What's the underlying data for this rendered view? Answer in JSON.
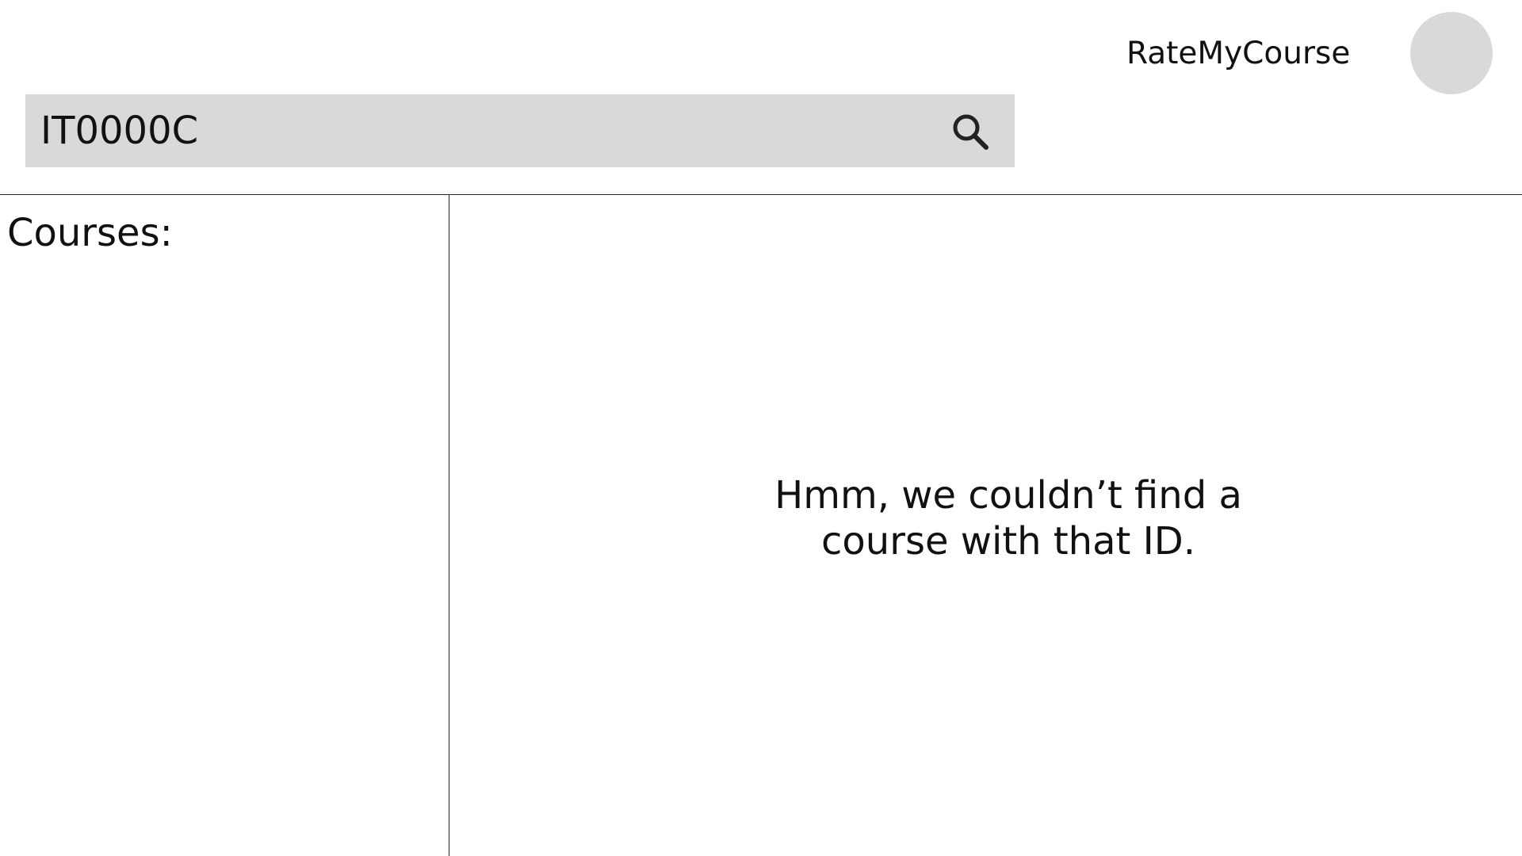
{
  "header": {
    "brand": "RateMyCourse",
    "search": {
      "value": "IT0000C"
    },
    "search_icon": "search-icon",
    "avatar_color": "#d9d9d9"
  },
  "sidebar": {
    "title": "Courses:"
  },
  "main": {
    "message_line1": "Hmm, we couldn’t find a",
    "message_line2": "course with that ID."
  }
}
